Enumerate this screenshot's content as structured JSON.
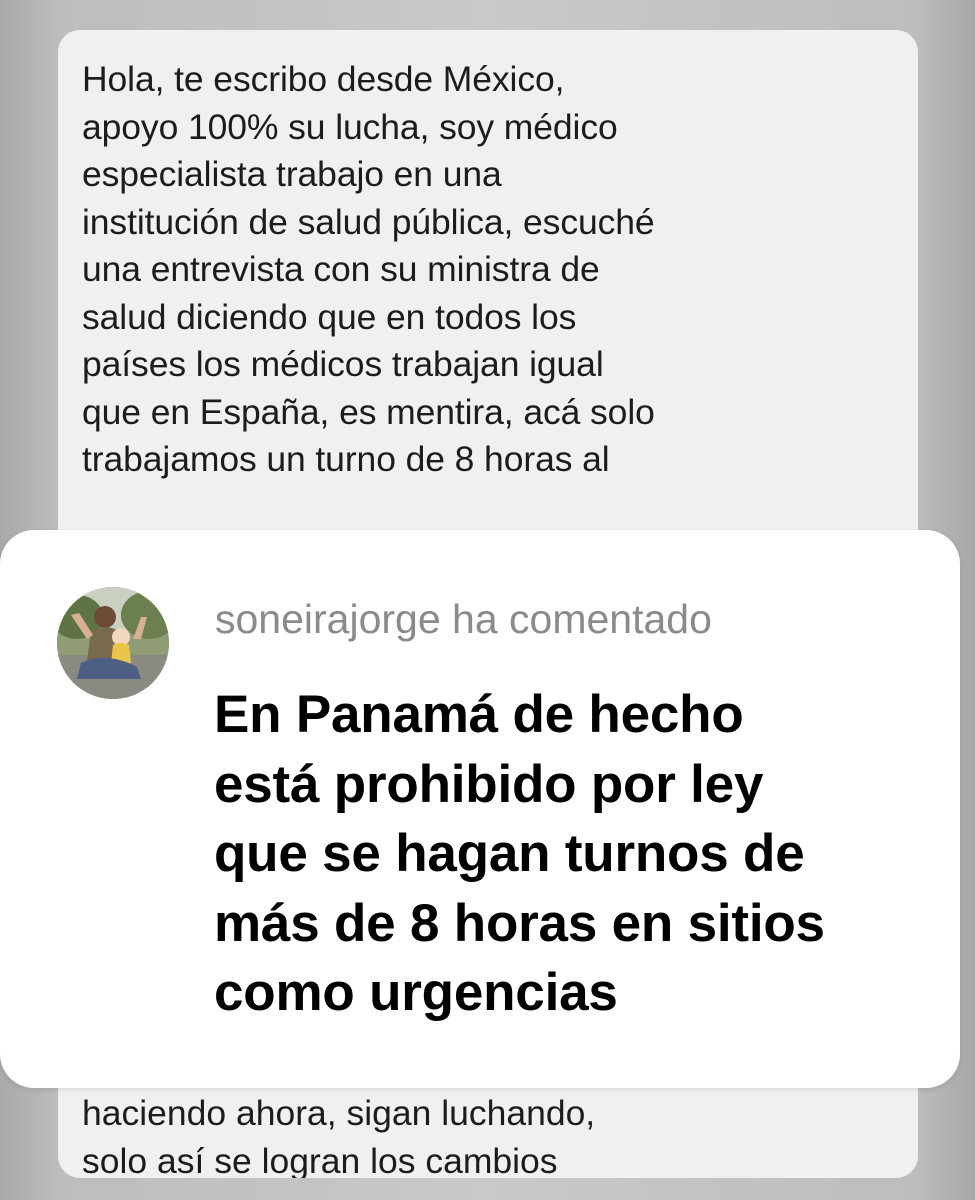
{
  "message": {
    "text_top": "Hola, te escribo desde México,\napoyo 100% su lucha, soy médico\nespecialista trabajo en una\ninstitución de salud pública, escuché\nuna entrevista con su ministra de\nsalud diciendo que en todos los\npaíses los médicos trabajan igual\nque en España, es mentira, acá solo\ntrabajamos un turno de 8 horas al",
    "text_bottom": "haciendo ahora, sigan luchando,\nsolo así se logran los cambios"
  },
  "comment": {
    "avatar_icon": "user-photo-avatar",
    "author_line": "soneirajorge ha comentado",
    "body": "En Panamá de hecho\nestá prohibido por ley\nque se hagan turnos de\nmás de 8 horas en sitios\ncomo urgencias"
  },
  "colors": {
    "bubble_bg": "#f0f0f1",
    "card_bg": "#ffffff",
    "author_gray": "#8a8a8c",
    "page_bg": "#c4c4c4"
  }
}
